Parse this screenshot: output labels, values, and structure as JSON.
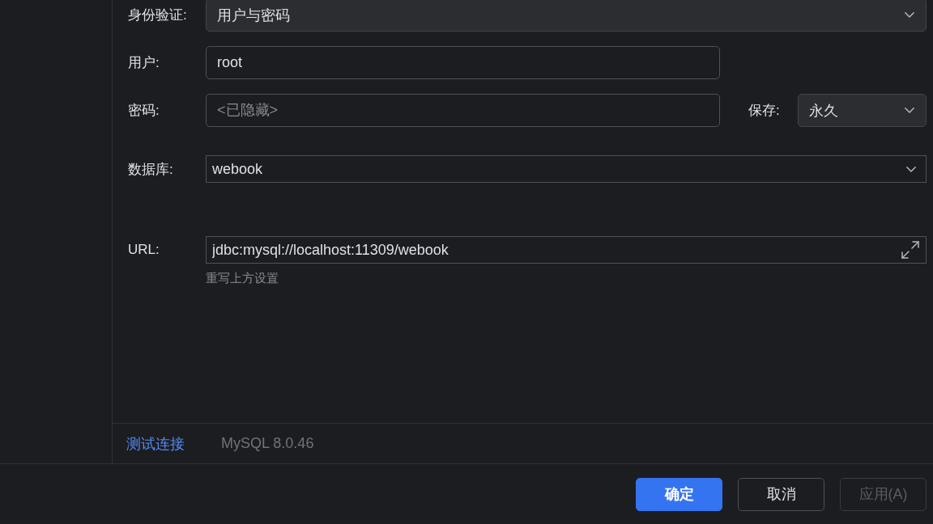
{
  "form": {
    "rows": [
      {
        "label": "身份验证:",
        "field": {
          "kind": "combo",
          "value": "用户与密码"
        }
      },
      {
        "label": "用户:",
        "field": {
          "kind": "text",
          "value": "root"
        }
      },
      {
        "label": "密码:",
        "field": {
          "kind": "password",
          "placeholder": "<已隐藏>"
        },
        "extra": {
          "label": "保存:",
          "field": {
            "kind": "combo",
            "value": "永久"
          }
        }
      },
      {
        "label": "数据库:",
        "field": {
          "kind": "dropdown",
          "value": "webook"
        }
      },
      {
        "label": "URL:",
        "field": {
          "kind": "url",
          "value": "jdbc:mysql://localhost:11309/webook"
        },
        "hint": "重写上方设置"
      }
    ]
  },
  "footer": {
    "link": "测试连接",
    "version": "MySQL 8.0.46"
  },
  "buttons": [
    {
      "label": "确定",
      "kind": "primary",
      "disabled": false
    },
    {
      "label": "取消",
      "kind": "secondary",
      "disabled": false
    },
    {
      "label": "应用(A)",
      "kind": "secondary",
      "disabled": true
    }
  ]
}
